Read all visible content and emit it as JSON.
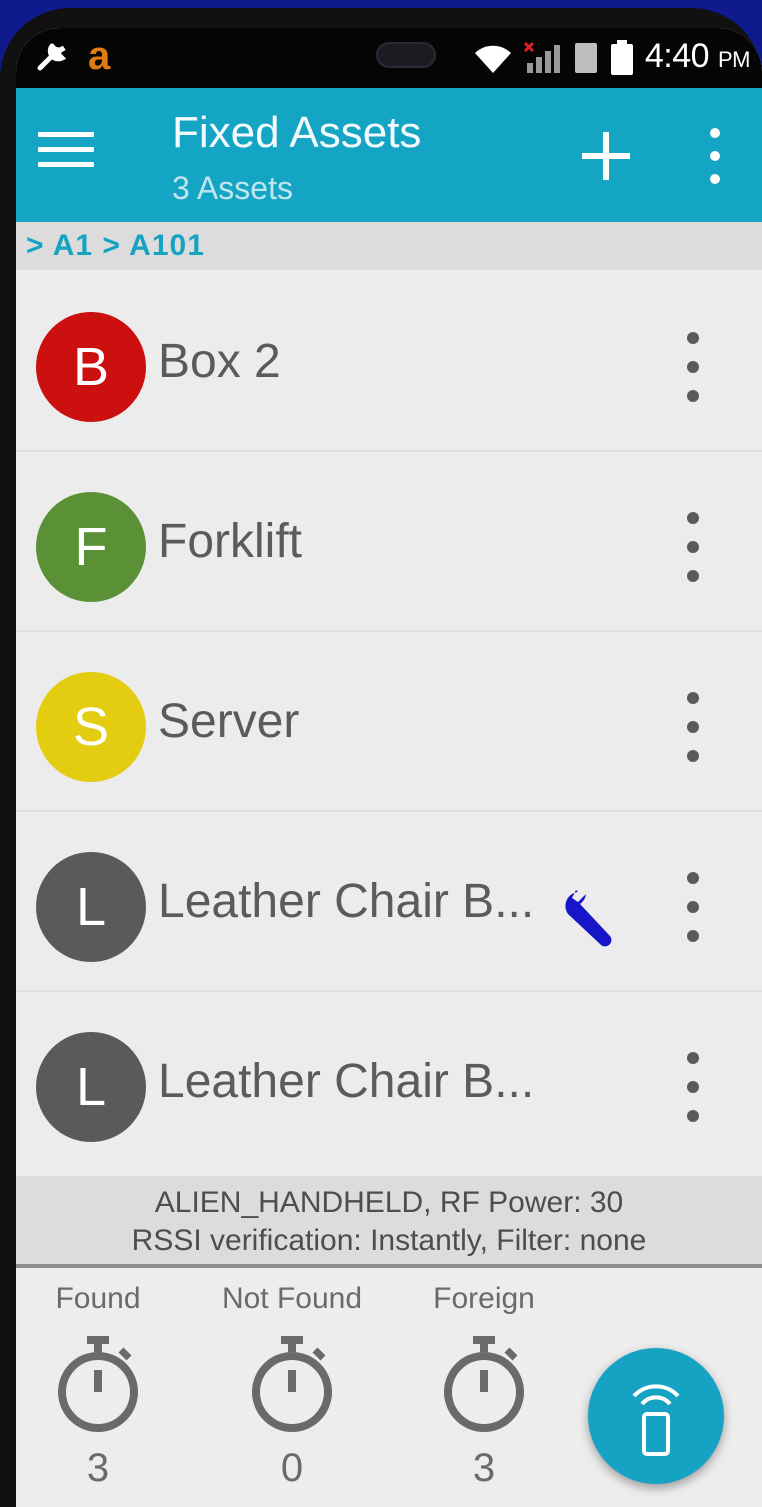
{
  "status_bar": {
    "app_letter": "a",
    "time": "4:40",
    "ampm": "PM"
  },
  "app_bar": {
    "title": "Fixed Assets",
    "subtitle": "3 Assets"
  },
  "breadcrumb": "> A1 > A101",
  "assets": [
    {
      "initial": "B",
      "name": "Box 2",
      "color": "#cc1010",
      "maintenance": false
    },
    {
      "initial": "F",
      "name": "Forklift",
      "color": "#5b9136",
      "maintenance": false
    },
    {
      "initial": "S",
      "name": "Server",
      "color": "#e4cc10",
      "maintenance": false
    },
    {
      "initial": "L",
      "name": "Leather Chair B...",
      "color": "#5a5a5a",
      "maintenance": true
    },
    {
      "initial": "L",
      "name": "Leather Chair B...",
      "color": "#5a5a5a",
      "maintenance": false
    }
  ],
  "reader_info": {
    "line1": "ALIEN_HANDHELD, RF Power: 30",
    "line2": "RSSI verification: Instantly, Filter: none"
  },
  "counters": {
    "found": {
      "label": "Found",
      "value": "3"
    },
    "not_found": {
      "label": "Not Found",
      "value": "0"
    },
    "foreign": {
      "label": "Foreign",
      "value": "3"
    }
  },
  "colors": {
    "accent": "#14a5c5",
    "maintenance_icon": "#1616c8"
  }
}
